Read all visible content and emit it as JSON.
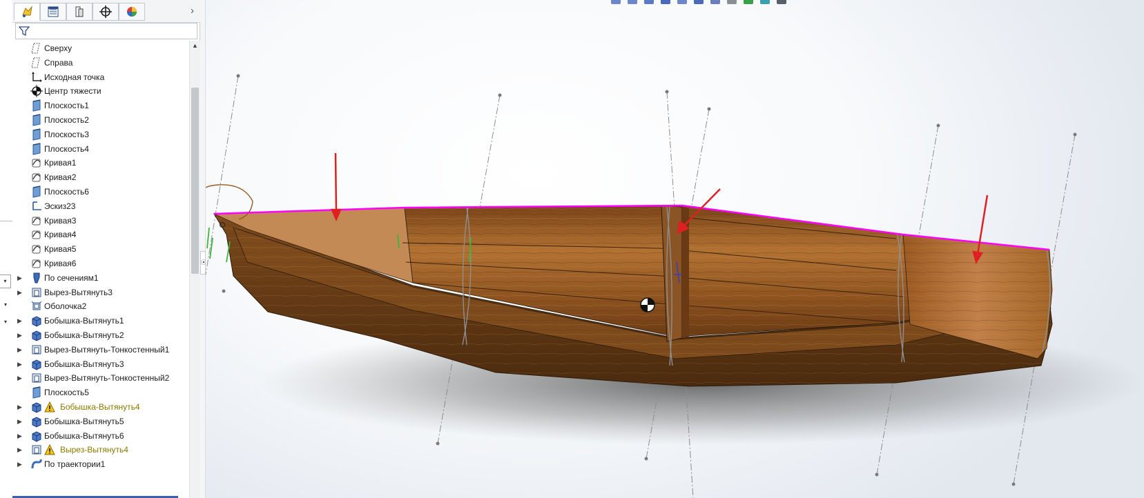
{
  "feature_manager": {
    "tabs": [
      {
        "name": "featuremanager-tab",
        "icon": "feature-tree-icon",
        "active": true
      },
      {
        "name": "propertymanager-tab",
        "icon": "property-list-icon",
        "active": false
      },
      {
        "name": "configurationmanager-tab",
        "icon": "configuration-icon",
        "active": false
      },
      {
        "name": "dimxpertmanager-tab",
        "icon": "crosshair-target-icon",
        "active": false
      },
      {
        "name": "displaymanager-tab",
        "icon": "color-wheel-icon",
        "active": false
      }
    ],
    "filter": {
      "value": "",
      "placeholder": ""
    },
    "tree": [
      {
        "label": "Сверху",
        "icon": "plane-icon",
        "expandable": false,
        "warning": false
      },
      {
        "label": "Справа",
        "icon": "plane-icon",
        "expandable": false,
        "warning": false
      },
      {
        "label": "Исходная точка",
        "icon": "origin-icon",
        "expandable": false,
        "warning": false
      },
      {
        "label": "Центр тяжести",
        "icon": "center-of-mass-icon",
        "expandable": false,
        "warning": false
      },
      {
        "label": "Плоскость1",
        "icon": "ref-plane-icon",
        "expandable": false,
        "warning": false
      },
      {
        "label": "Плоскость2",
        "icon": "ref-plane-icon",
        "expandable": false,
        "warning": false
      },
      {
        "label": "Плоскость3",
        "icon": "ref-plane-icon",
        "expandable": false,
        "warning": false
      },
      {
        "label": "Плоскость4",
        "icon": "ref-plane-icon",
        "expandable": false,
        "warning": false
      },
      {
        "label": "Кривая1",
        "icon": "curve-icon",
        "expandable": false,
        "warning": false
      },
      {
        "label": "Кривая2",
        "icon": "curve-icon",
        "expandable": false,
        "warning": false
      },
      {
        "label": "Плоскость6",
        "icon": "ref-plane-icon",
        "expandable": false,
        "warning": false
      },
      {
        "label": "Эскиз23",
        "icon": "sketch-icon",
        "expandable": false,
        "warning": false
      },
      {
        "label": "Кривая3",
        "icon": "curve-icon",
        "expandable": false,
        "warning": false
      },
      {
        "label": "Кривая4",
        "icon": "curve-icon",
        "expandable": false,
        "warning": false
      },
      {
        "label": "Кривая5",
        "icon": "curve-icon",
        "expandable": false,
        "warning": false
      },
      {
        "label": "Кривая6",
        "icon": "curve-icon",
        "expandable": false,
        "warning": false
      },
      {
        "label": "По сечениям1",
        "icon": "loft-icon",
        "expandable": true,
        "warning": false
      },
      {
        "label": "Вырез-Вытянуть3",
        "icon": "cut-extrude-icon",
        "expandable": true,
        "warning": false
      },
      {
        "label": "Оболочка2",
        "icon": "shell-icon",
        "expandable": false,
        "warning": false
      },
      {
        "label": "Бобышка-Вытянуть1",
        "icon": "boss-extrude-icon",
        "expandable": true,
        "warning": false
      },
      {
        "label": "Бобышка-Вытянуть2",
        "icon": "boss-extrude-icon",
        "expandable": true,
        "warning": false
      },
      {
        "label": "Вырез-Вытянуть-Тонкостенный1",
        "icon": "cut-extrude-icon",
        "expandable": true,
        "warning": false
      },
      {
        "label": "Бобышка-Вытянуть3",
        "icon": "boss-extrude-icon",
        "expandable": true,
        "warning": false
      },
      {
        "label": "Вырез-Вытянуть-Тонкостенный2",
        "icon": "cut-extrude-icon",
        "expandable": true,
        "warning": false
      },
      {
        "label": "Плоскость5",
        "icon": "ref-plane-icon",
        "expandable": false,
        "warning": false
      },
      {
        "label": "Бобышка-Вытянуть4",
        "icon": "boss-extrude-icon",
        "expandable": true,
        "warning": true
      },
      {
        "label": "Бобышка-Вытянуть5",
        "icon": "boss-extrude-icon",
        "expandable": true,
        "warning": false
      },
      {
        "label": "Бобышка-Вытянуть6",
        "icon": "boss-extrude-icon",
        "expandable": true,
        "warning": false
      },
      {
        "label": "Вырез-Вытянуть4",
        "icon": "cut-extrude-icon",
        "expandable": true,
        "warning": true
      },
      {
        "label": "По траектории1",
        "icon": "sweep-icon",
        "expandable": true,
        "warning": false
      }
    ]
  },
  "heads_up_toolbar": {
    "icons": [
      "zoom-to-fit-icon",
      "zoom-to-area-icon",
      "previous-view-icon",
      "section-view-icon",
      "dynamic-annotation-icon",
      "view-orientation-icon",
      "display-style-icon",
      "hide-show-items-icon",
      "edit-appearance-icon",
      "apply-scene-icon",
      "view-settings-icon"
    ],
    "colors": [
      "#6f86c9",
      "#6f86c9",
      "#5a7ac4",
      "#4b6ab8",
      "#6f86c9",
      "#4b6ab8",
      "#6a7fbf",
      "#8a8f96",
      "#3aa04a",
      "#39a0b0",
      "#5a6068"
    ]
  },
  "model": {
    "annotation_arrows": 3,
    "highlight_edge_color": "#ff00ff",
    "annotation_arrow_color": "#e02020",
    "wood_colors": [
      "#6b3a14",
      "#8a4f1e",
      "#a8692d",
      "#c48a4f"
    ]
  }
}
